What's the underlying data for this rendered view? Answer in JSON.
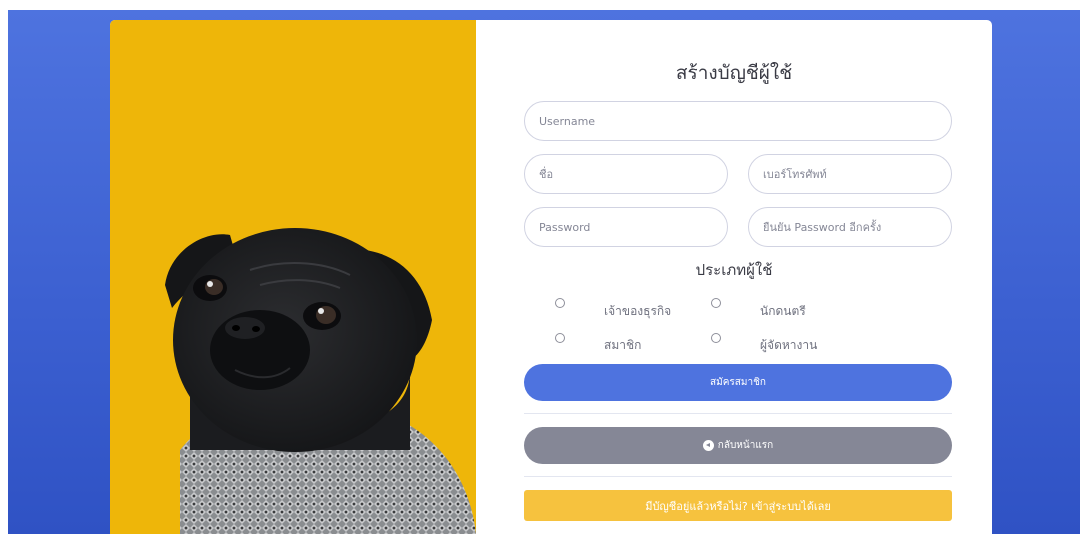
{
  "form": {
    "title": "สร้างบัญชีผู้ใช้",
    "username_placeholder": "Username",
    "name_placeholder": "ชื่อ",
    "phone_placeholder": "เบอร์โทรศัพท์",
    "password_placeholder": "Password",
    "confirm_password_placeholder": "ยืนยัน Password อีกครั้ง",
    "user_type_title": "ประเภทผู้ใช้",
    "user_types": [
      "เจ้าของธุรกิจ",
      "นักดนตรี",
      "สมาชิก",
      "ผู้จัดหางาน"
    ],
    "register_label": "สมัครสมาชิก",
    "back_label": "กลับหน้าแรก",
    "login_link_label": "มีบัญชีอยู่แล้วหรือไม่? เข้าสู่ระบบได้เลย"
  },
  "colors": {
    "background": "#4e73df",
    "image_panel": "#eeb609",
    "primary": "#4e73df",
    "secondary": "#858796",
    "warning": "#f6c23e"
  }
}
